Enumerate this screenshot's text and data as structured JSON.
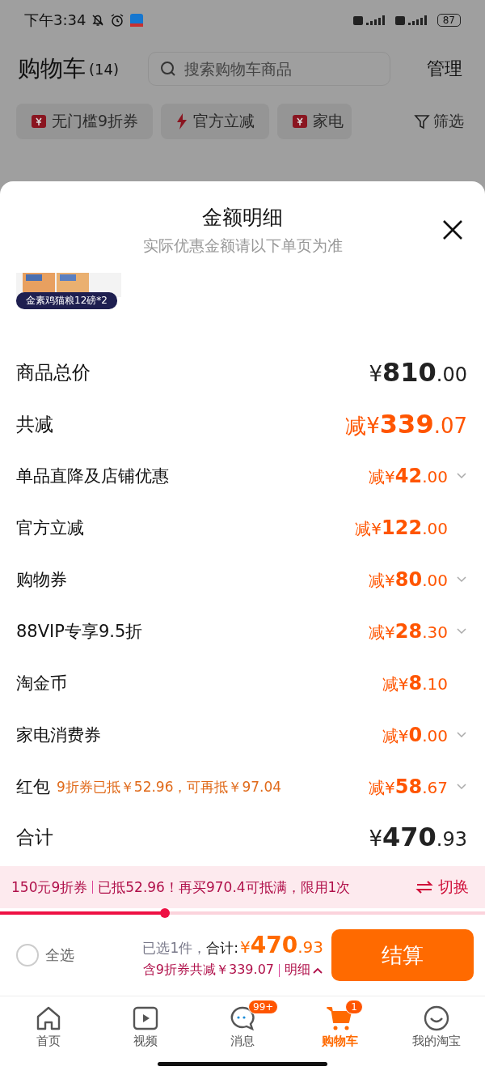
{
  "status_bar": {
    "time": "下午3:34",
    "battery": "87"
  },
  "header": {
    "title": "购物车",
    "count": "(14)",
    "search": {
      "placeholder": "搜索购物车商品"
    },
    "manage": "管理"
  },
  "filter_chips": [
    {
      "label": "无门槛9折券"
    },
    {
      "label": "官方立减"
    },
    {
      "label": "家电"
    }
  ],
  "filter": "筛选",
  "sheet": {
    "title": "金额明细",
    "subtitle": "实际优惠金额请以下单页为准",
    "product": {
      "kind": "picture",
      "label": "金素鸡猫粮12磅*2"
    },
    "rows": [
      {
        "kind": "total",
        "label": "商品总价",
        "prefix": "¥",
        "integer": "810",
        "decimal": ".00",
        "expandable": false
      },
      {
        "kind": "saving",
        "label": "共减",
        "prefix": "减¥",
        "integer": "339",
        "decimal": ".07",
        "expandable": false
      },
      {
        "kind": "item",
        "label": "单品直降及店铺优惠",
        "prefix": "减¥",
        "integer": "42",
        "decimal": ".00",
        "expandable": true
      },
      {
        "kind": "item",
        "label": "官方立减",
        "prefix": "减¥",
        "integer": "122",
        "decimal": ".00",
        "expandable": false
      },
      {
        "kind": "item",
        "label": "购物券",
        "prefix": "减¥",
        "integer": "80",
        "decimal": ".00",
        "expandable": true
      },
      {
        "kind": "item",
        "label": "88VIP专享9.5折",
        "prefix": "减¥",
        "integer": "28",
        "decimal": ".30",
        "expandable": true
      },
      {
        "kind": "item",
        "label": "淘金币",
        "prefix": "减¥",
        "integer": "8",
        "decimal": ".10",
        "expandable": false
      },
      {
        "kind": "item",
        "label": "家电消费券",
        "prefix": "减¥",
        "integer": "0",
        "decimal": ".00",
        "expandable": true
      },
      {
        "kind": "item",
        "label": "红包",
        "note": "9折券已抵￥52.96，可再抵￥97.04",
        "prefix": "减¥",
        "integer": "58",
        "decimal": ".67",
        "expandable": true
      },
      {
        "kind": "total",
        "label": "合计",
        "prefix": "¥",
        "integer": "470",
        "decimal": ".93",
        "expandable": false
      }
    ]
  },
  "coupon_bar": {
    "name": "150元9折券",
    "message": "已抵52.96！再买970.4可抵满，限用1次",
    "switch": "切换",
    "level": 0.34
  },
  "checkout": {
    "select_all": {
      "label": "全选",
      "checked": false
    },
    "selected": "已选1件，",
    "total_label": "合计:",
    "prefix": "¥",
    "integer": "470",
    "decimal": ".93",
    "savings": "含9折券共减￥339.07",
    "detail": "明细",
    "button": "结算"
  },
  "tabs": [
    {
      "label": "首页",
      "selected": false
    },
    {
      "label": "视频",
      "selected": false
    },
    {
      "label": "消息",
      "selected": false,
      "badge": "99+"
    },
    {
      "label": "购物车",
      "selected": true,
      "badge": "1"
    },
    {
      "label": "我的淘宝",
      "selected": false
    }
  ]
}
